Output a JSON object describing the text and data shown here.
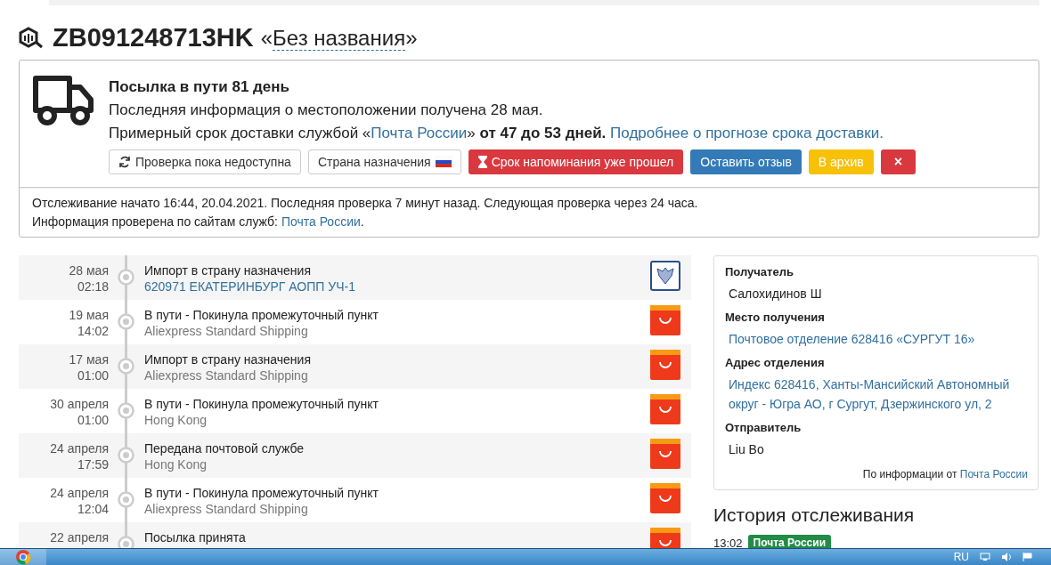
{
  "header": {
    "tracking_number": "ZB091248713HK",
    "name_open": "«",
    "name": "Без названия",
    "name_close": "»"
  },
  "summary": {
    "title": "Посылка в пути 81 день",
    "location_line": "Последняя информация о местоположении получена 28 мая.",
    "estimate_prefix": "Примерный срок доставки службой «",
    "estimate_service": "Почта России",
    "estimate_mid": "» ",
    "estimate_bold": "от 47 до 53 дней.",
    "estimate_link": "Подробнее о прогнозе срока доставки.",
    "buttons": [
      {
        "kind": "refresh",
        "label": "Проверка пока недоступна"
      },
      {
        "kind": "country",
        "label": "Страна назначения"
      },
      {
        "kind": "reminder",
        "label": "Срок напоминания уже прошел"
      },
      {
        "kind": "review",
        "label": "Оставить отзыв"
      },
      {
        "kind": "archive",
        "label": "В архив"
      },
      {
        "kind": "delete",
        "label": "×"
      }
    ],
    "footer_line1": "Отслеживание начато 16:44, 20.04.2021. Последняя проверка 7 минут назад. Следующая проверка через 24 часа.",
    "footer_line2_prefix": "Информация проверена по сайтам служб: ",
    "footer_line2_link": "Почта России",
    "footer_line2_suffix": "."
  },
  "timeline": [
    {
      "date": "28 мая",
      "time": "02:18",
      "title": "Импорт в страну назначения",
      "subtitle": {
        "text": "620971 ЕКАТЕРИНБУРГ АОПП УЧ-1",
        "kind": "link"
      },
      "kind": "russian-post"
    },
    {
      "date": "19 мая",
      "time": "14:02",
      "title": "В пути - Покинула промежуточный пункт",
      "subtitle": {
        "text": "Aliexpress Standard Shipping",
        "kind": "plain"
      },
      "kind": "aliexpress"
    },
    {
      "date": "17 мая",
      "time": "01:00",
      "title": "Импорт в страну назначения",
      "subtitle": {
        "text": "Aliexpress Standard Shipping",
        "kind": "plain"
      },
      "kind": "aliexpress"
    },
    {
      "date": "30 апреля",
      "time": "01:00",
      "title": "В пути - Покинула промежуточный пункт",
      "subtitle": {
        "text": "Hong Kong",
        "kind": "plain"
      },
      "kind": "aliexpress"
    },
    {
      "date": "24 апреля",
      "time": "17:59",
      "title": "Передана почтовой службе",
      "subtitle": {
        "text": "Hong Kong",
        "kind": "plain"
      },
      "kind": "aliexpress"
    },
    {
      "date": "24 апреля",
      "time": "12:04",
      "title": "В пути - Покинула промежуточный пункт",
      "subtitle": {
        "text": "Aliexpress Standard Shipping",
        "kind": "plain"
      },
      "kind": "aliexpress"
    },
    {
      "date": "22 апреля",
      "title": "Посылка принята",
      "kind": "aliexpress"
    }
  ],
  "details": {
    "fields": [
      {
        "label": "Получатель",
        "value": "Салохидинов Ш",
        "kind": "plain"
      },
      {
        "label": "Место получения",
        "value": "Почтовое отделение 628416 «СУРГУТ 16»",
        "kind": "link"
      },
      {
        "label": "Адрес отделения",
        "value": "Индекс 628416, Ханты-Мансийский Автономный округ - Югра АО, г Сургут, Дзержинского ул, 2",
        "kind": "link"
      },
      {
        "label": "Отправитель",
        "value": "Liu Bo",
        "kind": "plain"
      }
    ],
    "source_prefix": "По информации от ",
    "source_link": "Почта России"
  },
  "history": {
    "title": "История отслеживания",
    "entries": [
      {
        "time": "13:02",
        "service": "Почта России"
      }
    ]
  },
  "taskbar": {
    "language": "RU"
  }
}
